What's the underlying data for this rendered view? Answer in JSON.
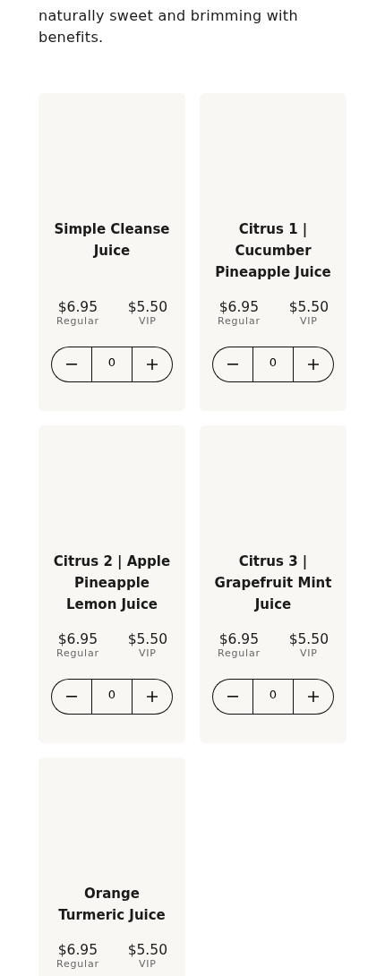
{
  "intro": "naturally sweet and brimming with benefits.",
  "products": [
    {
      "name": "Simple Cleanse Juice",
      "regular_price": "$6.95",
      "regular_label": "Regular",
      "vip_price": "$5.50",
      "vip_label": "VIP",
      "quantity": "0"
    },
    {
      "name": "Citrus 1 | Cucumber Pineapple Juice",
      "regular_price": "$6.95",
      "regular_label": "Regular",
      "vip_price": "$5.50",
      "vip_label": "VIP",
      "quantity": "0"
    },
    {
      "name": "Citrus 2 | Apple Pineapple Lemon Juice",
      "regular_price": "$6.95",
      "regular_label": "Regular",
      "vip_price": "$5.50",
      "vip_label": "VIP",
      "quantity": "0"
    },
    {
      "name": "Citrus 3 | Grapefruit Mint Juice",
      "regular_price": "$6.95",
      "regular_label": "Regular",
      "vip_price": "$5.50",
      "vip_label": "VIP",
      "quantity": "0"
    },
    {
      "name": "Orange Turmeric Juice",
      "regular_price": "$6.95",
      "regular_label": "Regular",
      "vip_price": "$5.50",
      "vip_label": "VIP"
    }
  ]
}
